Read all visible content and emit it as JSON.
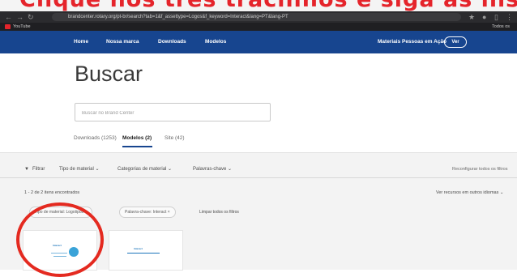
{
  "browser": {
    "url": "brandcenter.rotary.org/pt-br/search?tab=1&f_assettype=Logos&f_keyword=Interact&lang=PT&lang-PT",
    "bookmark": "YouTube",
    "bookmark_right": "Todos os"
  },
  "site_nav": {
    "items": [
      "Home",
      "Nossa marca",
      "Downloads",
      "Modelos"
    ],
    "promo": "Materiais Pessoas em Ação",
    "promo_button": "Ver"
  },
  "page": {
    "title": "Buscar",
    "search_placeholder": "Buscar no Brand Center"
  },
  "tabs": [
    {
      "label": "Downloads (1253)",
      "active": false
    },
    {
      "label": "Modelos (2)",
      "active": true
    },
    {
      "label": "Site (42)",
      "active": false
    }
  ],
  "filters": {
    "filter_label": "Filtrar",
    "dropdowns": [
      "Tipo de material",
      "Categorias de material",
      "Palavras-chave"
    ],
    "reset": "Reconfigurar todos os filtros"
  },
  "results": {
    "count_text": "1 - 2 de 2 itens encontrados",
    "other_langs": "Ver recursos em outros idiomas",
    "chips": [
      "Tipo de material: Logotipos ×",
      "Palavra-chave: Interact ×"
    ],
    "clear": "Limpar todos os filtros"
  },
  "cards": [
    {
      "brand": "Interact"
    },
    {
      "brand": "Interact"
    }
  ],
  "colors": {
    "nav_blue": "#17458f",
    "annotation_red": "#e42a20",
    "logo_blue": "#3aa3d8"
  }
}
